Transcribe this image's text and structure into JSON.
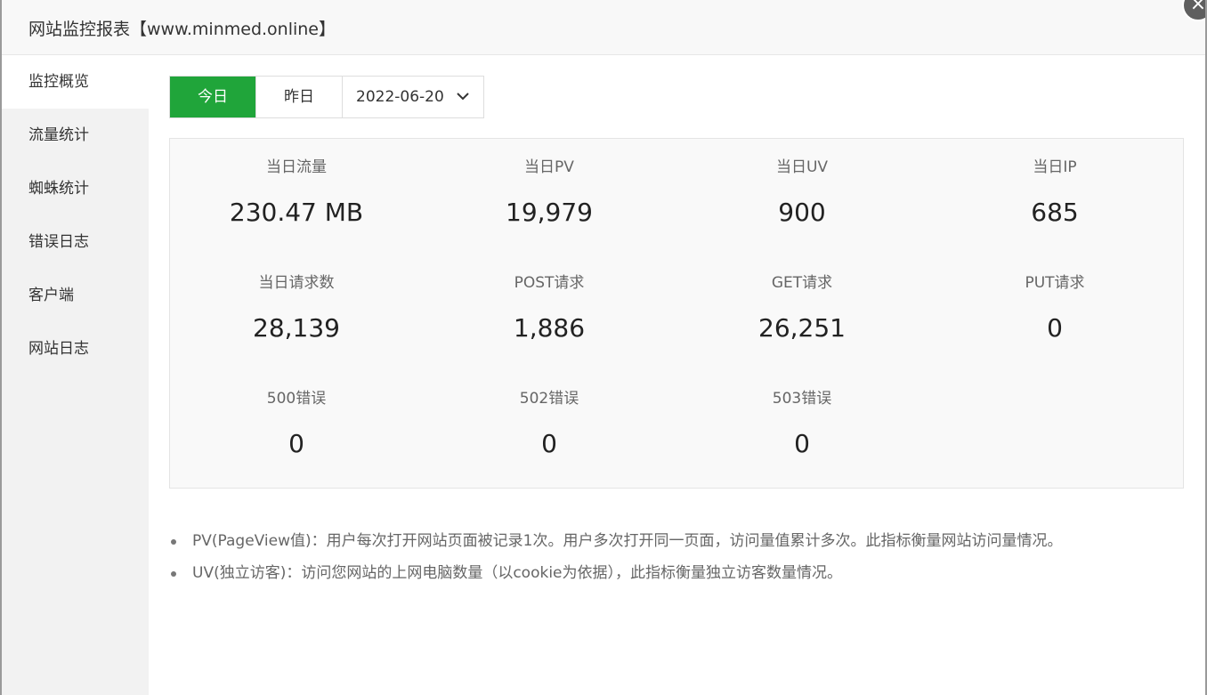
{
  "dialog": {
    "title": "网站监控报表【www.minmed.online】",
    "close_symbol": "×"
  },
  "sidebar": {
    "items": [
      {
        "label": "监控概览",
        "active": true
      },
      {
        "label": "流量统计",
        "active": false
      },
      {
        "label": "蜘蛛统计",
        "active": false
      },
      {
        "label": "错误日志",
        "active": false
      },
      {
        "label": "客户端",
        "active": false
      },
      {
        "label": "网站日志",
        "active": false
      }
    ]
  },
  "toolbar": {
    "today_label": "今日",
    "yesterday_label": "昨日",
    "date_value": "2022-06-20"
  },
  "stats": [
    {
      "label": "当日流量",
      "value": "230.47 MB"
    },
    {
      "label": "当日PV",
      "value": "19,979"
    },
    {
      "label": "当日UV",
      "value": "900"
    },
    {
      "label": "当日IP",
      "value": "685"
    },
    {
      "label": "当日请求数",
      "value": "28,139"
    },
    {
      "label": "POST请求",
      "value": "1,886"
    },
    {
      "label": "GET请求",
      "value": "26,251"
    },
    {
      "label": "PUT请求",
      "value": "0"
    },
    {
      "label": "500错误",
      "value": "0"
    },
    {
      "label": "502错误",
      "value": "0"
    },
    {
      "label": "503错误",
      "value": "0"
    }
  ],
  "notes": [
    "PV(PageView值)：用户每次打开网站页面被记录1次。用户多次打开同一页面，访问量值累计多次。此指标衡量网站访问量情况。",
    "UV(独立访客)：访问您网站的上网电脑数量（以cookie为依据），此指标衡量独立访客数量情况。"
  ],
  "colors": {
    "accent": "#20a53a",
    "sidebar_bg": "#f2f2f2",
    "stats_bg": "#f9f9f9"
  }
}
